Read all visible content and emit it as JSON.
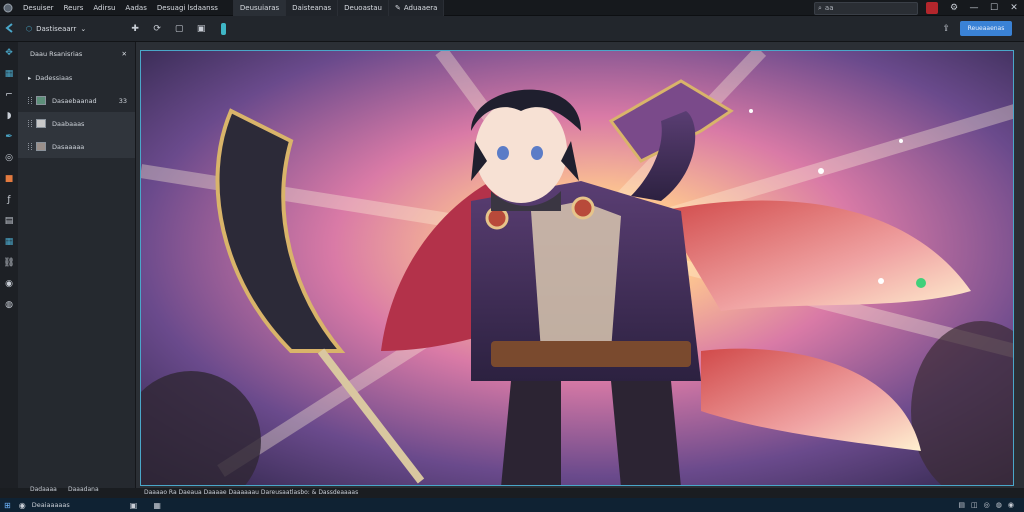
{
  "menubar": {
    "items": [
      "Desuiser",
      "Reurs",
      "Adirsu",
      "Aadas",
      "Desuagi lsdaanss"
    ],
    "tabs": [
      "Deusuiaras",
      "Daisteanas",
      "Deuoastau",
      "Aduaaera"
    ],
    "search_value": "aa"
  },
  "toolbar": {
    "project_label": "Dastiseaarr",
    "primary_button": "Reueaaenas"
  },
  "sidebar": {
    "header": "Daau Rsanisrias",
    "items": [
      {
        "label": "Dadessiaas"
      },
      {
        "label": "Dasaebaanad",
        "badge": "33"
      },
      {
        "label": "Daabaaas"
      },
      {
        "label": "Dasaaaaa"
      }
    ]
  },
  "footer_left": [
    "Dadaaaa",
    "Daaadana"
  ],
  "statusbar": {
    "text": "Daaaao Ra Daeaua Daaaae Daaaaaau Dareusaatlasbo: & Dassdeaaaas"
  },
  "taskbar": {
    "start_label": "Deaiaaaaas"
  },
  "colors": {
    "accent": "#3a82d6",
    "canvas_border": "#4aa7c9",
    "danger": "#b3262c"
  }
}
